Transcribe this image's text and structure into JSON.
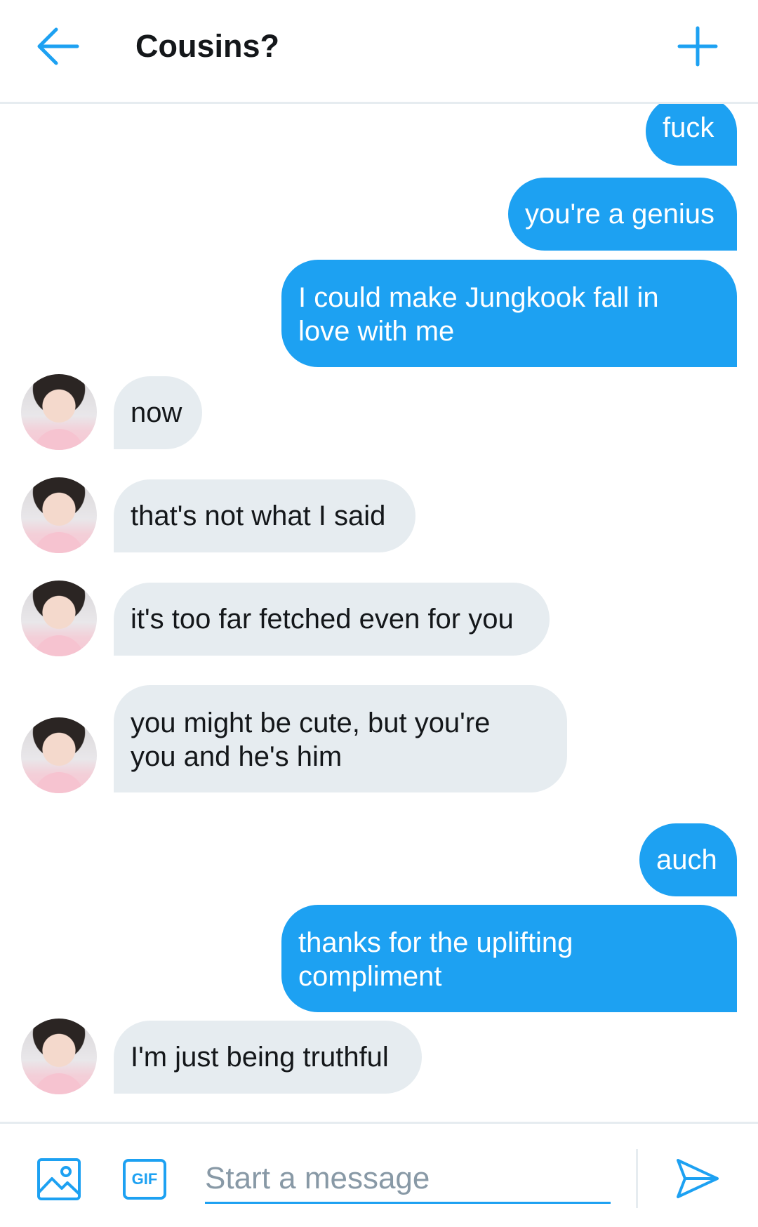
{
  "header": {
    "title": "Cousins?",
    "back_icon": "arrow-left-icon",
    "add_icon": "plus-icon",
    "accent": "#1da1f2"
  },
  "messages": [
    {
      "side": "sent",
      "text": "fuck"
    },
    {
      "side": "sent",
      "text": "you're a genius"
    },
    {
      "side": "sent",
      "text": "I could make Jungkook fall in\nlove with me"
    },
    {
      "side": "received",
      "text": "now"
    },
    {
      "side": "received",
      "text": "that's not what I said"
    },
    {
      "side": "received",
      "text": "it's too far fetched even for you"
    },
    {
      "side": "received",
      "text": "you might be cute, but you're\nyou and he's him"
    },
    {
      "side": "sent",
      "text": "auch"
    },
    {
      "side": "sent",
      "text": "thanks for the uplifting\ncompliment"
    },
    {
      "side": "received",
      "text": "I'm just being truthful"
    }
  ],
  "colors": {
    "sent_bubble": "#1da1f2",
    "received_bubble": "#e6ecf0",
    "placeholder": "#8899a6"
  },
  "composer": {
    "image_icon": "image-icon",
    "gif_label": "GIF",
    "placeholder": "Start a message",
    "value": "",
    "send_icon": "send-icon"
  }
}
